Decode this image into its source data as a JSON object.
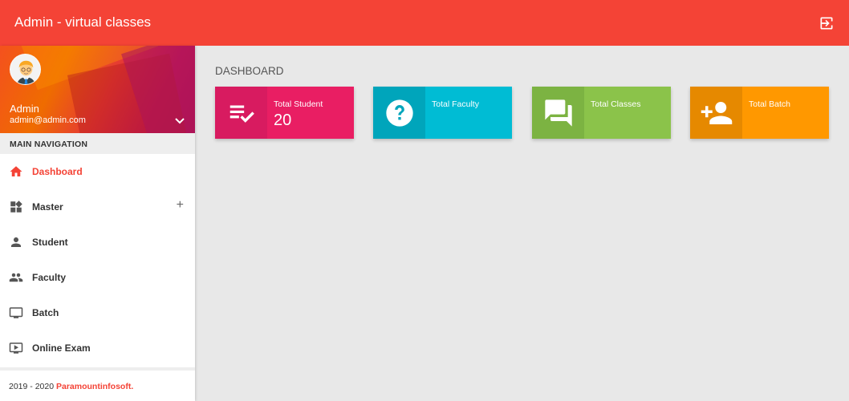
{
  "app": {
    "title": "Admin - virtual classes"
  },
  "user": {
    "name": "Admin",
    "email": "admin@admin.com"
  },
  "sidebar": {
    "header": "MAIN NAVIGATION",
    "items": [
      {
        "label": "Dashboard",
        "icon": "home-icon"
      },
      {
        "label": "Master",
        "icon": "widgets-icon",
        "expand": "+"
      },
      {
        "label": "Student",
        "icon": "person-icon"
      },
      {
        "label": "Faculty",
        "icon": "people-icon"
      },
      {
        "label": "Batch",
        "icon": "monitor-icon"
      },
      {
        "label": "Online Exam",
        "icon": "video-icon"
      }
    ],
    "footer": {
      "years": "2019 - 2020",
      "brand": "Paramountinfosoft",
      "suffix": "."
    }
  },
  "main": {
    "page_title": "DASHBOARD",
    "cards": [
      {
        "label": "Total Student",
        "value": "20",
        "icon": "checklist-icon",
        "color": "#e91e63",
        "icon_bg": "#d81b60"
      },
      {
        "label": "Total Faculty",
        "value": "",
        "icon": "help-icon",
        "color": "#00bcd4",
        "icon_bg": "#00a5bb"
      },
      {
        "label": "Total Classes",
        "value": "",
        "icon": "forum-icon",
        "color": "#8bc34a",
        "icon_bg": "#7cb342"
      },
      {
        "label": "Total Batch",
        "value": "",
        "icon": "add-person-icon",
        "color": "#ff9800",
        "icon_bg": "#e68900"
      }
    ]
  },
  "colors": {
    "accent": "#f44336",
    "active_nav": "#f44336"
  }
}
